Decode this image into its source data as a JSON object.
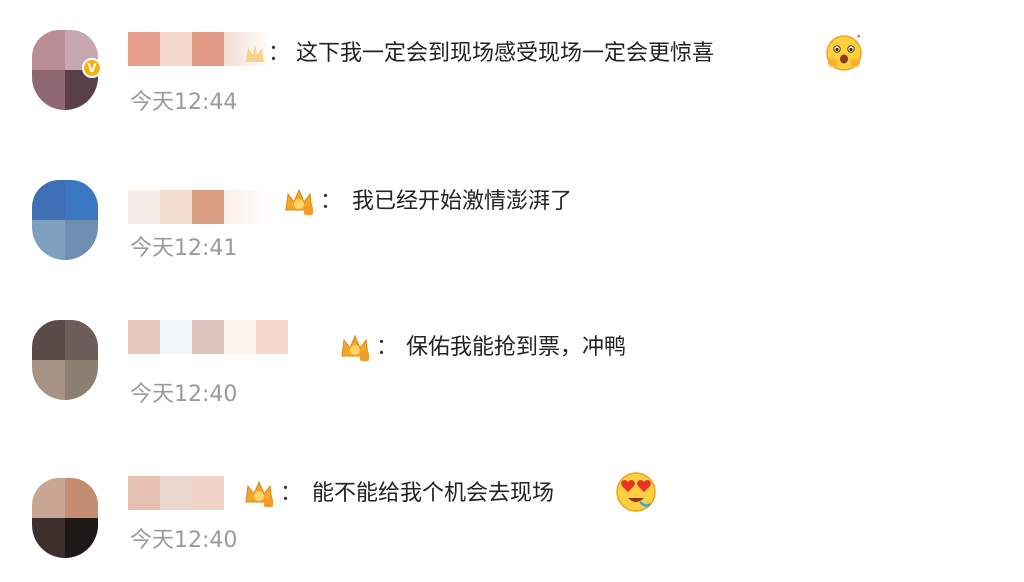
{
  "comments": [
    {
      "text": "这下我一定会到现场感受现场一定会更惊喜",
      "time": "今天12:44",
      "emoji": "surprised-hands-emoji"
    },
    {
      "text": "我已经开始激情澎湃了",
      "time": "今天12:41"
    },
    {
      "text": "保佑我能抢到票，冲鸭",
      "time": "今天12:40"
    },
    {
      "text": "能不能给我个机会去现场",
      "time": "今天12:40",
      "emoji": "heart-eyes-emoji"
    }
  ],
  "colon": "：",
  "colors": {
    "text": "#222222",
    "timestamp": "#9a9a9a",
    "verified_badge": "#f4b10f",
    "crown": "#f5a623"
  }
}
